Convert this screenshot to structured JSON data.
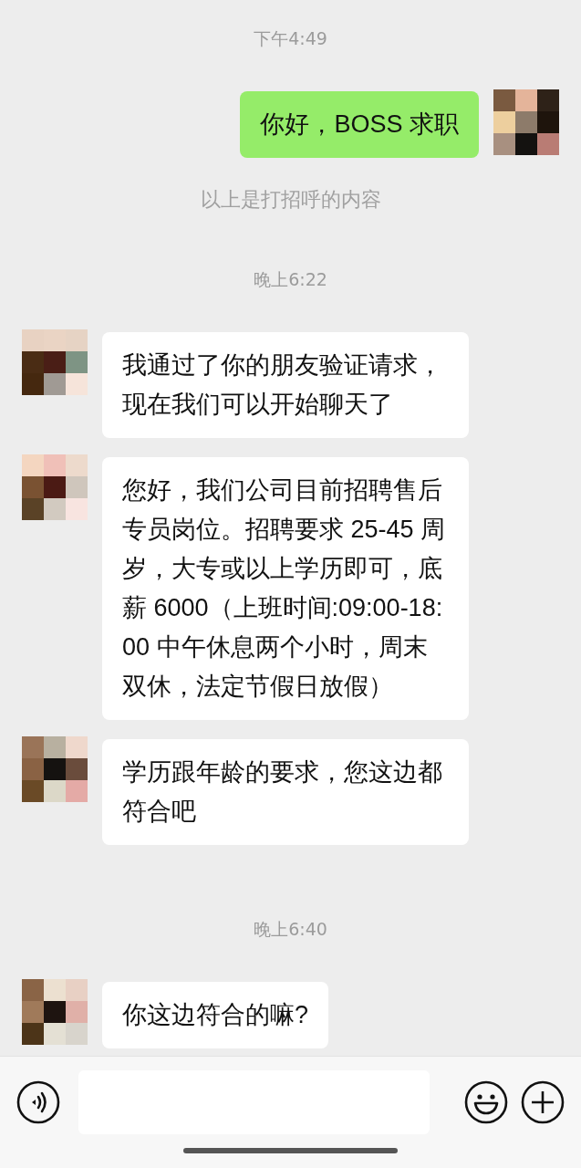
{
  "messages": [
    {
      "kind": "time",
      "text": "下午4:49"
    },
    {
      "kind": "sent",
      "text": "你好，BOSS 求职"
    },
    {
      "kind": "notice",
      "text": "以上是打招呼的内容"
    },
    {
      "kind": "time",
      "text": "晚上6:22"
    },
    {
      "kind": "received",
      "text": "我通过了你的朋友验证请求，现在我们可以开始聊天了"
    },
    {
      "kind": "received",
      "text": "您好，我们公司目前招聘售后专员岗位。招聘要求 25-45 周岁，大专或以上学历即可，底薪 6000（上班时间:09:00-18:00 中午休息两个小时，周末双休，法定节假日放假）"
    },
    {
      "kind": "received",
      "text": "学历跟年龄的要求，您这边都符合吧"
    },
    {
      "kind": "time",
      "text": "晚上6:40"
    },
    {
      "kind": "received",
      "text": "你这边符合的嘛?"
    }
  ]
}
